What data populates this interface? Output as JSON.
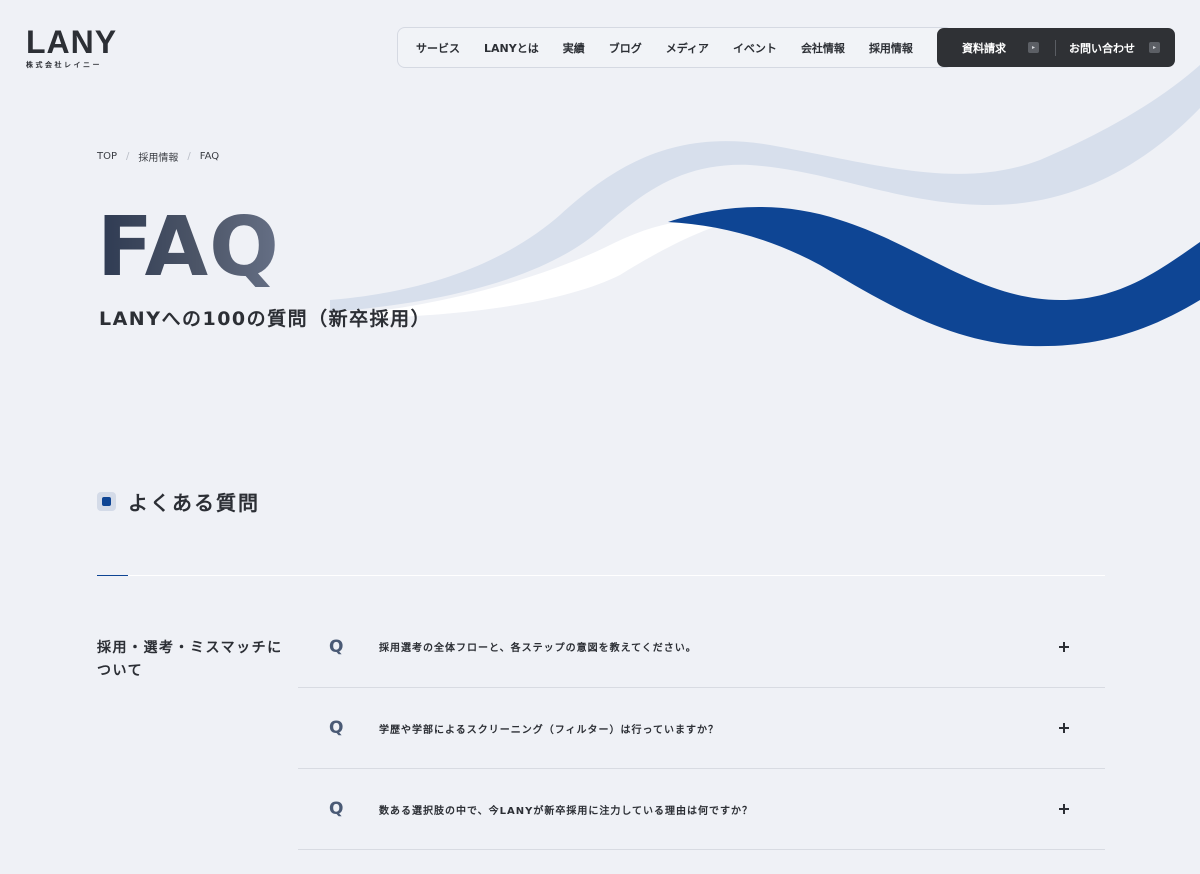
{
  "logo": {
    "main": "LANY",
    "sub": "株式会社レイニー"
  },
  "nav": {
    "items": [
      "サービス",
      "LANYとは",
      "実績",
      "ブログ",
      "メディア",
      "イベント",
      "会社情報",
      "採用情報"
    ]
  },
  "cta": {
    "request_docs": "資料請求",
    "contact": "お問い合わせ"
  },
  "breadcrumb": [
    "TOP",
    "採用情報",
    "FAQ"
  ],
  "hero": {
    "title": "FAQ",
    "subtitle": "LANYへの100の質問（新卒採用）"
  },
  "section": {
    "title": "よくある質問"
  },
  "category": {
    "title": "採用・選考・ミスマッチについて"
  },
  "faq": {
    "q_mark": "Q",
    "items": [
      "採用選考の全体フローと、各ステップの意図を教えてください。",
      "学歴や学部によるスクリーニング（フィルター）は行っていますか？",
      "数ある選択肢の中で、今LANYが新卒採用に注力している理由は何ですか？"
    ]
  },
  "colors": {
    "accent_navy": "#0e4594",
    "wave_light": "#d7dfec",
    "background": "#eff1f6",
    "cta_bg": "#2f3135"
  },
  "icons": {
    "expand": "plus-icon",
    "cta_arrow": "arrow-icon"
  }
}
